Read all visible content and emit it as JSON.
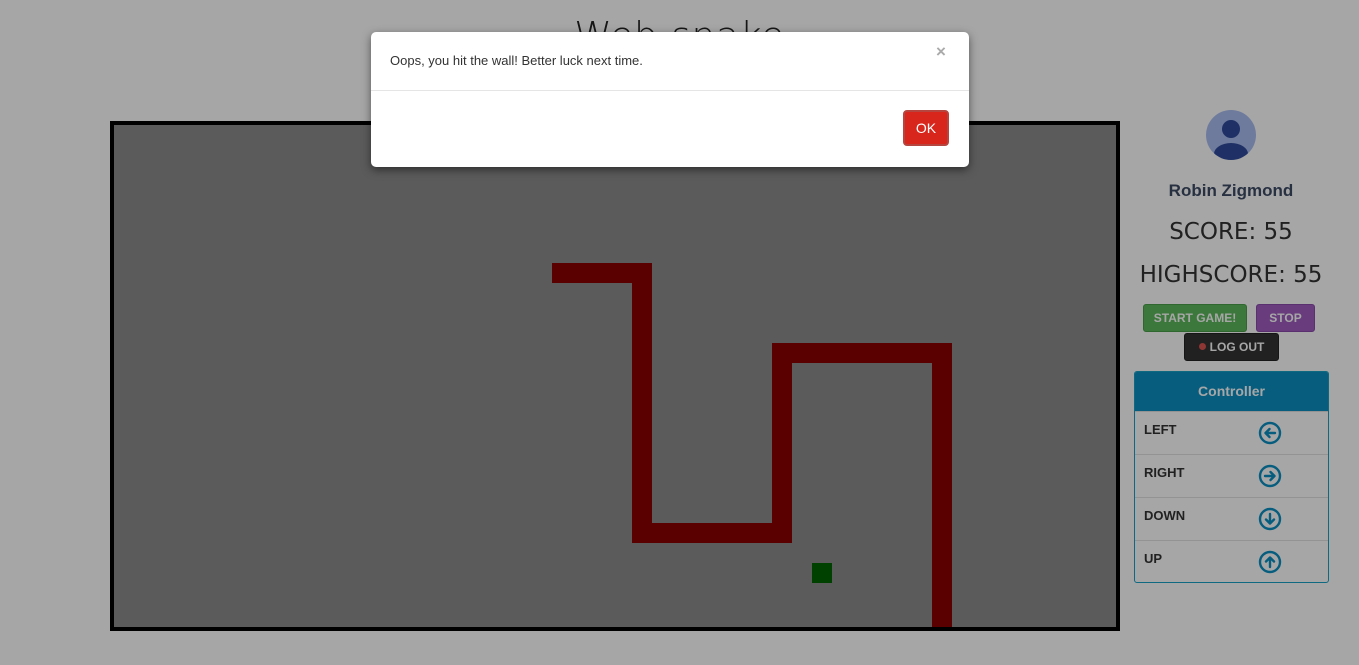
{
  "page": {
    "title": "Web snake"
  },
  "game": {
    "board_color": "#8d8d8d",
    "snake_color": "#8b0000",
    "food_color": "#006400",
    "grid": {
      "cols": 50,
      "rows": 25
    },
    "snake_path": [
      [
        22,
        7
      ],
      [
        26,
        7
      ],
      [
        26,
        20
      ],
      [
        33,
        20
      ],
      [
        33,
        11
      ],
      [
        41,
        11
      ],
      [
        41,
        25
      ]
    ],
    "food": [
      35,
      22
    ]
  },
  "player": {
    "name": "Robin Zigmond",
    "score_text": "SCORE: 55",
    "highscore_text": "HIGHSCORE: 55",
    "score": 55,
    "highscore": 55
  },
  "buttons": {
    "start": "START GAME!",
    "stop": "STOP",
    "logout": "LOG OUT"
  },
  "controller": {
    "title": "Controller",
    "accent_color": "#0a8fc2",
    "rows": [
      {
        "label": "LEFT",
        "icon": "arrow-left-circle-icon"
      },
      {
        "label": "RIGHT",
        "icon": "arrow-right-circle-icon"
      },
      {
        "label": "DOWN",
        "icon": "arrow-down-circle-icon"
      },
      {
        "label": "UP",
        "icon": "arrow-up-circle-icon"
      }
    ]
  },
  "modal": {
    "message": "Oops, you hit the wall! Better luck next time.",
    "close": "×",
    "ok": "OK",
    "ok_color": "#d9261c"
  }
}
